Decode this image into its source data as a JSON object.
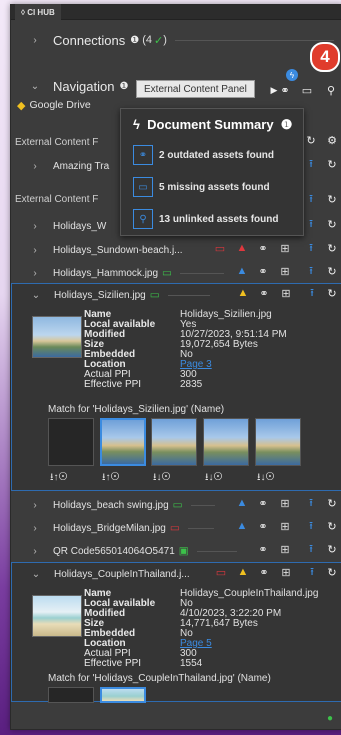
{
  "panel": {
    "tab_title": "CI HUB"
  },
  "connections": {
    "label": "Connections",
    "count_text": "(4",
    "check": "✓",
    "close_paren": ")"
  },
  "badge_number": "4",
  "navigation": {
    "label": "Navigation",
    "google_drive": "Google Drive",
    "tooltip": "External Content Panel"
  },
  "sections": {
    "external_content_1": "External Content F",
    "amazing": "Amazing Tra",
    "external_content_2": "External Content F"
  },
  "popup": {
    "title": "Document Summary",
    "items": [
      {
        "text": "2 outdated assets found",
        "icon": "link-icon"
      },
      {
        "text": "5 missing assets found",
        "icon": "monitor-icon"
      },
      {
        "text": "13 unlinked assets found",
        "icon": "search-icon"
      }
    ]
  },
  "files": {
    "holidays_w": "Holidays_W",
    "sundown": "Holidays_Sundown-beach.j...",
    "hammock": "Holidays_Hammock.jpg",
    "sizilien": "Holidays_Sizilien.jpg",
    "beach_swing": "Holidays_beach swing.jpg",
    "bridge": "Holidays_BridgeMilan.jpg",
    "qr": "QR Code565014064O5471",
    "couple": "Holidays_CoupleInThailand.j..."
  },
  "meta_labels": {
    "name": "Name",
    "local": "Local available",
    "modified": "Modified",
    "size": "Size",
    "embedded": "Embedded",
    "location": "Location",
    "actual_ppi": "Actual PPI",
    "effective_ppi": "Effective PPI"
  },
  "sizilien_meta": {
    "name": "Holidays_Sizilien.jpg",
    "local": "Yes",
    "modified": "10/27/2023, 9:51:14 PM",
    "size": "19,072,654 Bytes",
    "embedded": "No",
    "location": "Page 3",
    "actual_ppi": "300",
    "effective_ppi": "2835",
    "match": "Match for 'Holidays_Sizilien.jpg' (Name)"
  },
  "couple_meta": {
    "name": "Holidays_CoupleInThailand.jpg",
    "local": "No",
    "modified": "4/10/2023, 3:22:20 PM",
    "size": "14,771,647 Bytes",
    "embedded": "No",
    "location": "Page 5",
    "actual_ppi": "300",
    "effective_ppi": "1554",
    "match": "Match for 'Holidays_CoupleInThailand.jpg' (Name)"
  },
  "candidate_actions": [
    "⭳↑⊙",
    "⭳↑⊙",
    "⭳↓⊙",
    "⭳↓⊙",
    "⭳↓⊙"
  ],
  "colors": {
    "blue": "#3b8be0",
    "red": "#e0383e",
    "yellow": "#f0c020",
    "green": "#3cc14a",
    "badge": "#e03c2c"
  }
}
